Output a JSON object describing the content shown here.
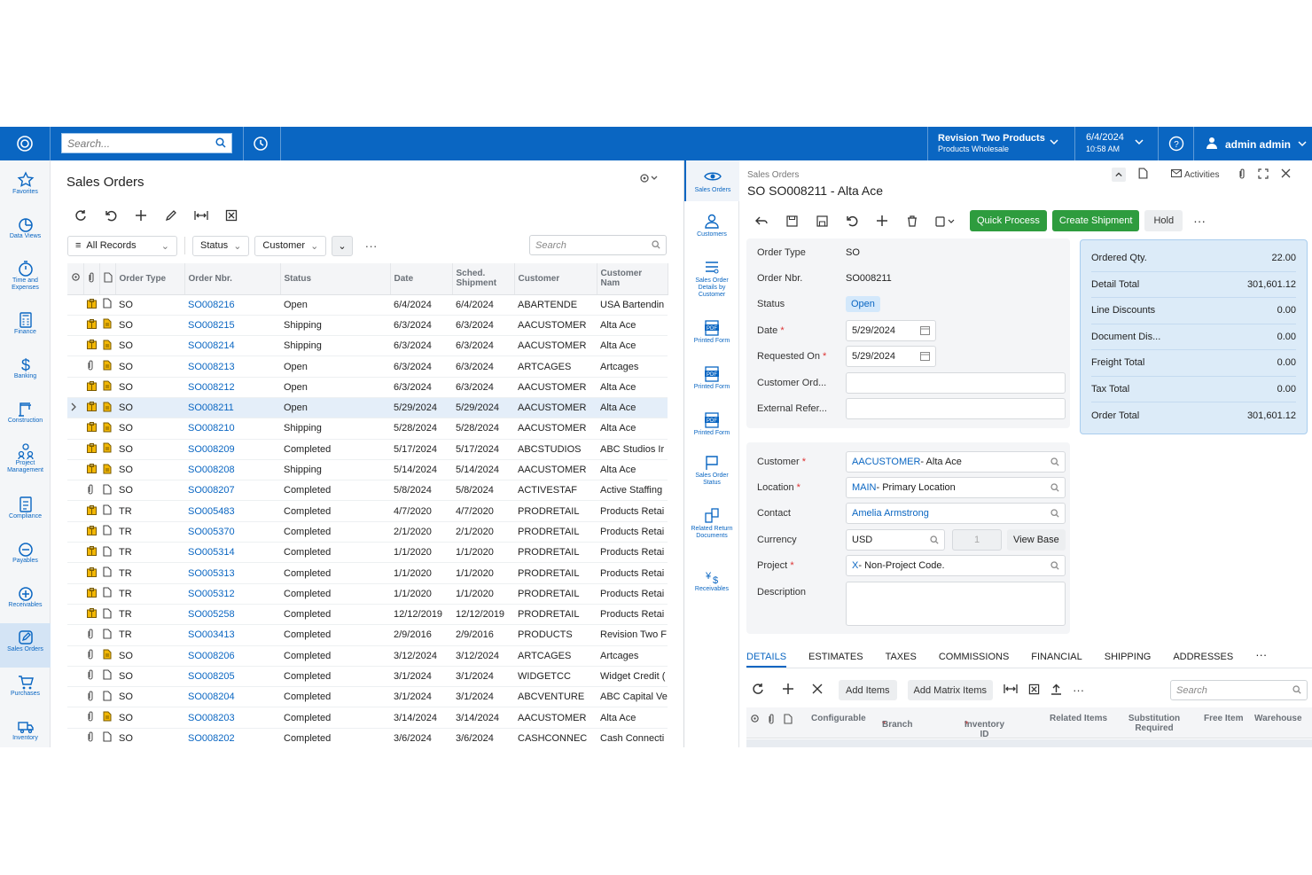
{
  "topbar": {
    "search_placeholder": "Search...",
    "tenant": "Revision Two Products",
    "tenant_sub": "Products Wholesale",
    "date": "6/4/2024",
    "time": "10:58 AM",
    "user": "admin admin"
  },
  "sidebar": [
    {
      "label": "Favorites",
      "icon": "star-icon"
    },
    {
      "label": "Data Views",
      "icon": "pie-chart-icon"
    },
    {
      "label": "Time and Expenses",
      "icon": "stopwatch-icon"
    },
    {
      "label": "Finance",
      "icon": "calculator-icon"
    },
    {
      "label": "Banking",
      "icon": "dollar-icon"
    },
    {
      "label": "Construction",
      "icon": "crane-icon"
    },
    {
      "label": "Project Management",
      "icon": "people-icon"
    },
    {
      "label": "Compliance",
      "icon": "checklist-icon"
    },
    {
      "label": "Payables",
      "icon": "minus-circle-icon"
    },
    {
      "label": "Receivables",
      "icon": "plus-circle-icon"
    },
    {
      "label": "Sales Orders",
      "icon": "edit-icon",
      "active": true
    },
    {
      "label": "Purchases",
      "icon": "cart-icon"
    },
    {
      "label": "Inventory",
      "icon": "truck-icon"
    }
  ],
  "list": {
    "title": "Sales Orders",
    "filters": [
      "All Records",
      "Status",
      "Customer"
    ],
    "search_placeholder": "Search",
    "columns": [
      "Order Type",
      "Order Nbr.",
      "Status",
      "Date",
      "Sched. Shipment",
      "Customer",
      "Customer Nam"
    ],
    "rows": [
      {
        "a": "box",
        "t": "SO",
        "nbr": "SO008216",
        "status": "Open",
        "date": "6/4/2024",
        "ship": "6/4/2024",
        "cust": "ABARTENDE",
        "name": "USA Bartendin",
        "note": false
      },
      {
        "a": "box",
        "t": "SO",
        "nbr": "SO008215",
        "status": "Shipping",
        "date": "6/3/2024",
        "ship": "6/3/2024",
        "cust": "AACUSTOMER",
        "name": "Alta Ace",
        "note": true
      },
      {
        "a": "box",
        "t": "SO",
        "nbr": "SO008214",
        "status": "Shipping",
        "date": "6/3/2024",
        "ship": "6/3/2024",
        "cust": "AACUSTOMER",
        "name": "Alta Ace",
        "note": true
      },
      {
        "a": "clip",
        "t": "SO",
        "nbr": "SO008213",
        "status": "Open",
        "date": "6/3/2024",
        "ship": "6/3/2024",
        "cust": "ARTCAGES",
        "name": "Artcages",
        "note": true
      },
      {
        "a": "box",
        "t": "SO",
        "nbr": "SO008212",
        "status": "Open",
        "date": "6/3/2024",
        "ship": "6/3/2024",
        "cust": "AACUSTOMER",
        "name": "Alta Ace",
        "note": true
      },
      {
        "a": "box",
        "t": "SO",
        "nbr": "SO008211",
        "status": "Open",
        "date": "5/29/2024",
        "ship": "5/29/2024",
        "cust": "AACUSTOMER",
        "name": "Alta Ace",
        "note": true,
        "sel": true
      },
      {
        "a": "box",
        "t": "SO",
        "nbr": "SO008210",
        "status": "Shipping",
        "date": "5/28/2024",
        "ship": "5/28/2024",
        "cust": "AACUSTOMER",
        "name": "Alta Ace",
        "note": true
      },
      {
        "a": "box",
        "t": "SO",
        "nbr": "SO008209",
        "status": "Completed",
        "date": "5/17/2024",
        "ship": "5/17/2024",
        "cust": "ABCSTUDIOS",
        "name": "ABC Studios Ir",
        "note": true
      },
      {
        "a": "box",
        "t": "SO",
        "nbr": "SO008208",
        "status": "Shipping",
        "date": "5/14/2024",
        "ship": "5/14/2024",
        "cust": "AACUSTOMER",
        "name": "Alta Ace",
        "note": true
      },
      {
        "a": "clip",
        "t": "SO",
        "nbr": "SO008207",
        "status": "Completed",
        "date": "5/8/2024",
        "ship": "5/8/2024",
        "cust": "ACTIVESTAF",
        "name": "Active Staffing",
        "note": false
      },
      {
        "a": "box",
        "t": "TR",
        "nbr": "SO005483",
        "status": "Completed",
        "date": "4/7/2020",
        "ship": "4/7/2020",
        "cust": "PRODRETAIL",
        "name": "Products Retai",
        "note": false
      },
      {
        "a": "box",
        "t": "TR",
        "nbr": "SO005370",
        "status": "Completed",
        "date": "2/1/2020",
        "ship": "2/1/2020",
        "cust": "PRODRETAIL",
        "name": "Products Retai",
        "note": false
      },
      {
        "a": "box",
        "t": "TR",
        "nbr": "SO005314",
        "status": "Completed",
        "date": "1/1/2020",
        "ship": "1/1/2020",
        "cust": "PRODRETAIL",
        "name": "Products Retai",
        "note": false
      },
      {
        "a": "box",
        "t": "TR",
        "nbr": "SO005313",
        "status": "Completed",
        "date": "1/1/2020",
        "ship": "1/1/2020",
        "cust": "PRODRETAIL",
        "name": "Products Retai",
        "note": false
      },
      {
        "a": "box",
        "t": "TR",
        "nbr": "SO005312",
        "status": "Completed",
        "date": "1/1/2020",
        "ship": "1/1/2020",
        "cust": "PRODRETAIL",
        "name": "Products Retai",
        "note": false
      },
      {
        "a": "box",
        "t": "TR",
        "nbr": "SO005258",
        "status": "Completed",
        "date": "12/12/2019",
        "ship": "12/12/2019",
        "cust": "PRODRETAIL",
        "name": "Products Retai",
        "note": false
      },
      {
        "a": "clip",
        "t": "TR",
        "nbr": "SO003413",
        "status": "Completed",
        "date": "2/9/2016",
        "ship": "2/9/2016",
        "cust": "PRODUCTS",
        "name": "Revision Two F",
        "note": false
      },
      {
        "a": "clip",
        "t": "SO",
        "nbr": "SO008206",
        "status": "Completed",
        "date": "3/12/2024",
        "ship": "3/12/2024",
        "cust": "ARTCAGES",
        "name": "Artcages",
        "note": true
      },
      {
        "a": "clip",
        "t": "SO",
        "nbr": "SO008205",
        "status": "Completed",
        "date": "3/1/2024",
        "ship": "3/1/2024",
        "cust": "WIDGETCC",
        "name": "Widget Credit (",
        "note": false
      },
      {
        "a": "clip",
        "t": "SO",
        "nbr": "SO008204",
        "status": "Completed",
        "date": "3/1/2024",
        "ship": "3/1/2024",
        "cust": "ABCVENTURE",
        "name": "ABC Capital Ve",
        "note": false
      },
      {
        "a": "clip",
        "t": "SO",
        "nbr": "SO008203",
        "status": "Completed",
        "date": "3/14/2024",
        "ship": "3/14/2024",
        "cust": "AACUSTOMER",
        "name": "Alta Ace",
        "note": true
      },
      {
        "a": "clip",
        "t": "SO",
        "nbr": "SO008202",
        "status": "Completed",
        "date": "3/6/2024",
        "ship": "3/6/2024",
        "cust": "CASHCONNEC",
        "name": "Cash Connecti",
        "note": false
      }
    ]
  },
  "rnav": [
    {
      "label": "Sales Orders",
      "icon": "eye-icon",
      "active": true
    },
    {
      "label": "Customers",
      "icon": "user-icon"
    },
    {
      "label": "Sales Order Details by Customer",
      "icon": "list-icon"
    },
    {
      "label": "Printed Form",
      "icon": "pdf-icon"
    },
    {
      "label": "Printed Form",
      "icon": "pdf-icon"
    },
    {
      "label": "Printed Form",
      "icon": "pdf-icon"
    },
    {
      "label": "Sales Order Status",
      "icon": "flag-icon"
    },
    {
      "label": "Related Return Documents",
      "icon": "return-icon"
    },
    {
      "label": "Receivables",
      "icon": "currency-icon"
    }
  ],
  "detail": {
    "crumb": "Sales Orders",
    "title": "SO SO008211 - Alta Ace",
    "activities": "Activities",
    "quick_process": "Quick Process",
    "create_shipment": "Create Shipment",
    "hold": "Hold",
    "order_type_lbl": "Order Type",
    "order_type": "SO",
    "order_nbr_lbl": "Order Nbr.",
    "order_nbr": "SO008211",
    "status_lbl": "Status",
    "status": "Open",
    "date_lbl": "Date",
    "date": "5/29/2024",
    "req_lbl": "Requested On",
    "req": "5/29/2024",
    "cust_ord_lbl": "Customer Ord...",
    "ext_ref_lbl": "External Refer...",
    "customer_lbl": "Customer",
    "customer_code": "AACUSTOMER",
    "customer_name": " - Alta Ace",
    "location_lbl": "Location",
    "location_code": "MAIN",
    "location_name": " - Primary Location",
    "contact_lbl": "Contact",
    "contact": "Amelia Armstrong",
    "currency_lbl": "Currency",
    "currency": "USD",
    "rate": "1",
    "view_base": "View Base",
    "project_lbl": "Project",
    "project_code": "X",
    "project_name": " - Non-Project Code.",
    "desc_lbl": "Description"
  },
  "totals": [
    {
      "label": "Ordered Qty.",
      "value": "22.00"
    },
    {
      "label": "Detail Total",
      "value": "301,601.12"
    },
    {
      "label": "Line Discounts",
      "value": "0.00"
    },
    {
      "label": "Document Dis...",
      "value": "0.00"
    },
    {
      "label": "Freight Total",
      "value": "0.00"
    },
    {
      "label": "Tax Total",
      "value": "0.00"
    },
    {
      "label": "Order Total",
      "value": "301,601.12"
    }
  ],
  "tabs": [
    "DETAILS",
    "ESTIMATES",
    "TAXES",
    "COMMISSIONS",
    "FINANCIAL",
    "SHIPPING",
    "ADDRESSES"
  ],
  "details_toolbar": {
    "add_items": "Add Items",
    "add_matrix": "Add Matrix Items",
    "search_placeholder": "Search"
  },
  "details_cols": {
    "configurable": "Configurable",
    "branch": "Branch",
    "inventory": "Inventory ID",
    "related": "Related Items",
    "substitution": "Substitution Required",
    "free": "Free Item",
    "warehouse": "Warehouse"
  }
}
